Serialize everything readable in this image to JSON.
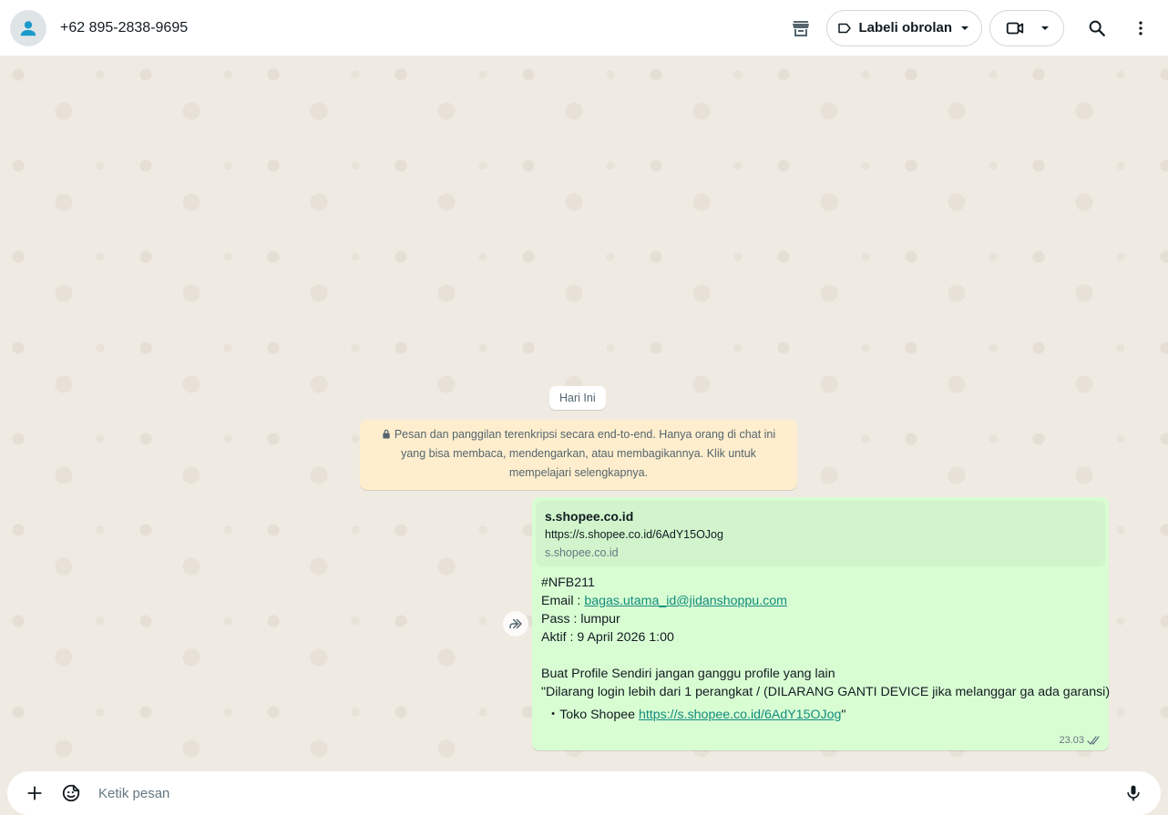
{
  "header": {
    "contact_name": "+62 895-2838-9695",
    "label_button": "Labeli obrolan",
    "icons": [
      "avatar-icon",
      "store-icon",
      "label-icon",
      "chevron-down-icon",
      "video-call-icon",
      "search-icon",
      "more-options-icon"
    ]
  },
  "chat": {
    "day_chip": "Hari Ini",
    "encryption_notice": "Pesan dan panggilan terenkripsi secara end-to-end. Hanya orang di chat ini yang bisa membaca, mendengarkan, atau membagikannya. Klik untuk mempelajari selengkapnya.",
    "message": {
      "link_preview": {
        "title": "s.shopee.co.id",
        "url": "https://s.shopee.co.id/6AdY15OJog",
        "domain": "s.shopee.co.id"
      },
      "line_code": "#NFB211",
      "email_label": "Email : ",
      "email_value": "bagas.utama_id@jidanshoppu.com",
      "pass_line": "Pass : lumpur",
      "active_line": "Aktif : 9 April 2026 1:00",
      "profile_line": "Buat Profile Sendiri jangan ganggu profile yang lain",
      "warning_line": "\"Dilarang login lebih dari 1 perangkat / (DILARANG GANTI DEVICE jika melanggar ga ada garansi)",
      "shop_prefix": "・Toko Shopee ",
      "shop_link": "https://s.shopee.co.id/6AdY15OJog",
      "shop_suffix": "\"",
      "time": "23.03",
      "status": "read"
    }
  },
  "composer": {
    "placeholder": "Ketik pesan",
    "icons": [
      "plus-icon",
      "sticker-icon",
      "microphone-icon"
    ]
  },
  "colors": {
    "outgoing_bubble": "#d9fdd3",
    "link_preview_bg": "#d1f4cc",
    "notice_bg": "#ffeecd",
    "chat_bg": "#efeae2",
    "link": "#128c7e"
  }
}
